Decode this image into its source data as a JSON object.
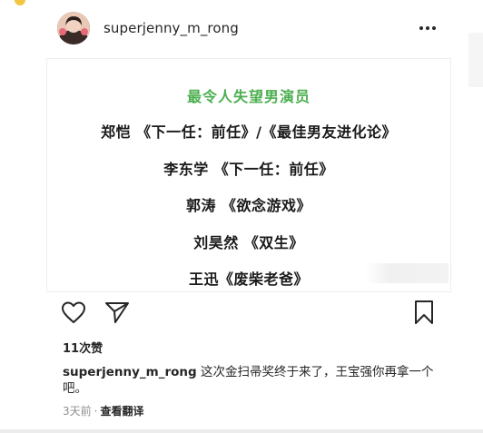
{
  "post": {
    "username": "superjenny_m_rong",
    "more_label": "•••"
  },
  "image_text": {
    "heading": "最令人失望男演员",
    "lines": [
      "郑恺 《下一任：前任》/《最佳男友进化论》",
      "李东学 《下一任：前任》",
      "郭涛 《欲念游戏》",
      "刘昊然 《双生》",
      "王迅《废柴老爸》"
    ]
  },
  "engagement": {
    "likes": "11次赞"
  },
  "caption": {
    "username": "superjenny_m_rong",
    "text": "这次金扫帚奖终于来了，王宝强你再拿一个吧。"
  },
  "meta": {
    "time_ago": "3天前",
    "separator": "·",
    "see_translation": "查看翻译"
  },
  "icons": {
    "more": "more-options-icon",
    "like": "heart-icon",
    "share": "send-icon",
    "save": "bookmark-icon"
  }
}
